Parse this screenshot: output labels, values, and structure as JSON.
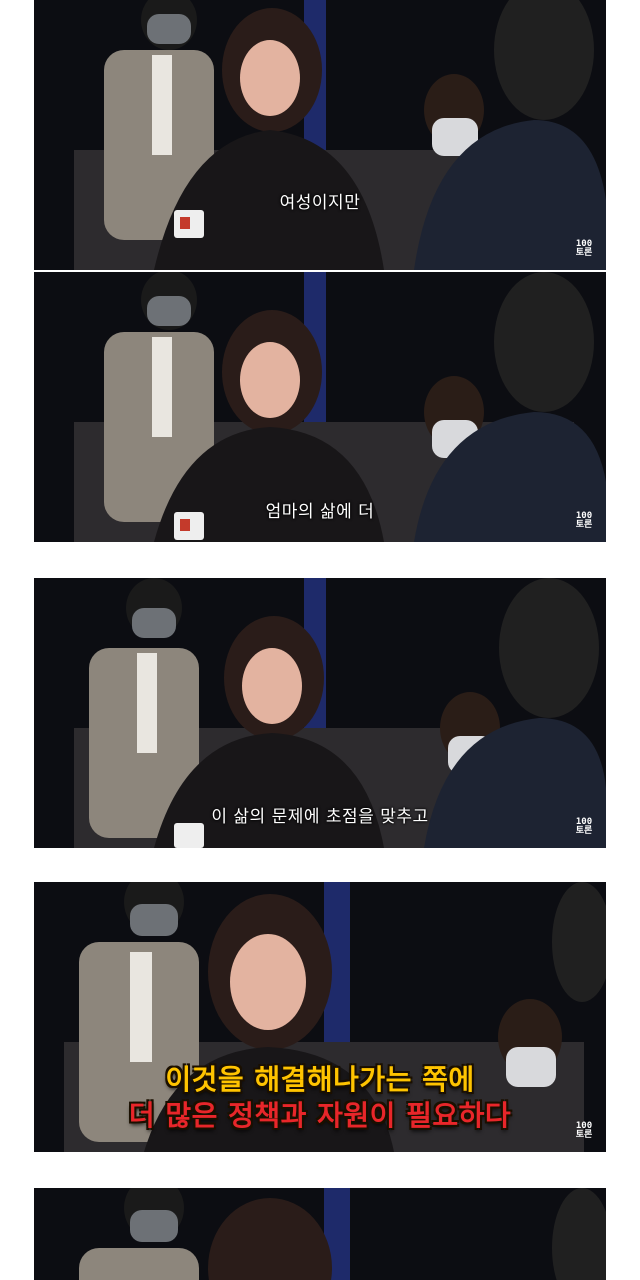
{
  "frames": [
    {
      "caption": "여성이지만"
    },
    {
      "caption": "엄마의 삶에 더"
    },
    {
      "caption": "이 삶의 문제에 초점을 맞추고"
    },
    {
      "caption_line1": "이것을 해결해나가는 쪽에",
      "caption_line2": "더 많은 정책과 자원이 필요하다"
    },
    {}
  ],
  "logo": {
    "top": "100",
    "bottom": "토론"
  },
  "colors": {
    "caption_yellow": "#ffc400",
    "caption_red": "#e8262a",
    "studio_background": "#0c0d12",
    "page_background": "#ffffff"
  }
}
